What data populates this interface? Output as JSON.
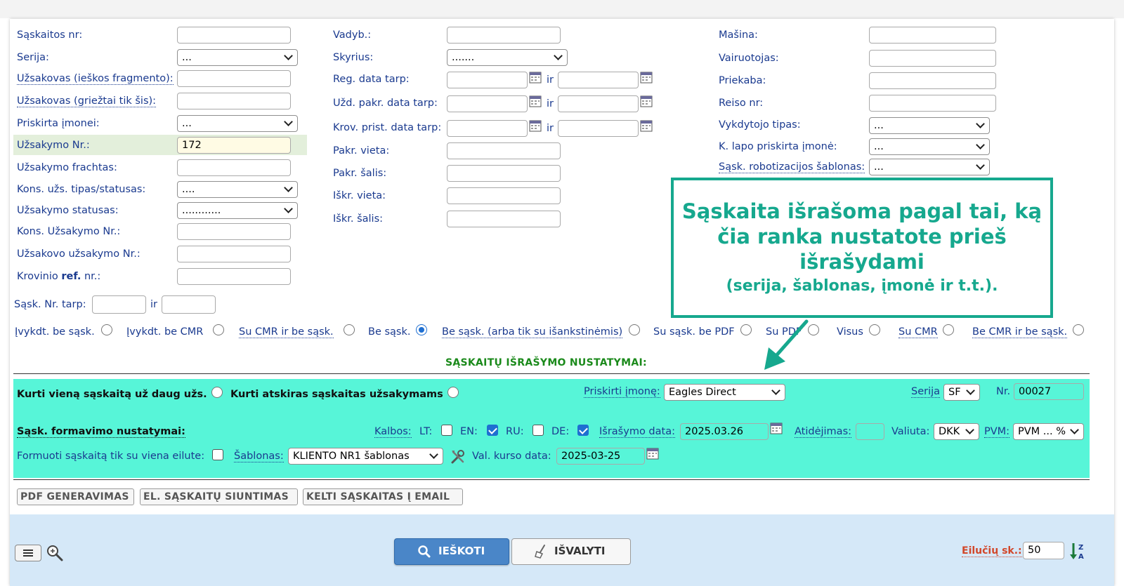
{
  "filters": {
    "col1": {
      "saskaitos_nr": {
        "label": "Sąskaitos nr:",
        "value": ""
      },
      "serija": {
        "label": "Serija:",
        "value": "..."
      },
      "uzsakovas_frag": {
        "label": "Užsakovas (ieškos fragmento):",
        "value": ""
      },
      "uzsakovas_griez": {
        "label": "Užsakovas (griežtai tik šis):",
        "value": ""
      },
      "priskirta_imonei": {
        "label": "Priskirta įmonei:",
        "value": "..."
      },
      "uzsakymo_nr": {
        "label": "Užsakymo Nr.:",
        "value": "172"
      },
      "uzsakymo_frachtas": {
        "label": "Užsakymo frachtas:",
        "value": ""
      },
      "kons_tipas": {
        "label": "Kons. užs. tipas/statusas:",
        "value": "...."
      },
      "uzsakymo_statusas": {
        "label": "Užsakymo statusas:",
        "value": "............"
      },
      "kons_uzsakymo_nr": {
        "label": "Kons. Užsakymo Nr.:",
        "value": ""
      },
      "uzsakovo_uzsakymo_nr": {
        "label": "Užsakovo užsakymo Nr.:",
        "value": ""
      },
      "krovinio_ref_pre": "Krovinio",
      "krovinio_ref_bold": "ref.",
      "krovinio_ref_post": "nr.:"
    },
    "col2": {
      "vadyb": {
        "label": "Vadyb.:",
        "value": ""
      },
      "skyrius": {
        "label": "Skyrius:",
        "value": "......."
      },
      "reg_data": {
        "label": "Reg. data tarp:",
        "ir": "ir"
      },
      "uzd_pakr": {
        "label": "Užd. pakr. data tarp:",
        "ir": "ir"
      },
      "krov_prist": {
        "label": "Krov. prist. data tarp:",
        "ir": "ir"
      },
      "pakr_vieta": {
        "label": "Pakr. vieta:",
        "value": ""
      },
      "pakr_salis": {
        "label": "Pakr. šalis:",
        "value": ""
      },
      "iskr_vieta": {
        "label": "Iškr. vieta:",
        "value": ""
      },
      "iskr_salis": {
        "label": "Iškr. šalis:",
        "value": ""
      }
    },
    "col3": {
      "masina": {
        "label": "Mašina:",
        "value": ""
      },
      "vairuotojas": {
        "label": "Vairuotojas:",
        "value": ""
      },
      "priekaba": {
        "label": "Priekaba:",
        "value": ""
      },
      "reiso_nr": {
        "label": "Reiso nr:",
        "value": ""
      },
      "vykdytojo_tipas": {
        "label": "Vykdytojo tipas:",
        "value": "..."
      },
      "k_lapo": {
        "label": "K. lapo priskirta įmonė:",
        "value": "..."
      },
      "robotizacijos": {
        "label": "Sąsk. robotizacijos šablonas:",
        "value": "..."
      }
    },
    "sask_nr_tarp": {
      "label": "Sąsk. Nr. tarp:",
      "ir": "ir"
    },
    "radios": [
      {
        "label": "Įvykdt. be sąsk.",
        "checked": false
      },
      {
        "label": "Įvykdt. be CMR",
        "checked": false
      },
      {
        "label": "Su CMR ir be sąsk.",
        "checked": false
      },
      {
        "label": "Be sąsk.",
        "checked": true
      },
      {
        "label": "Be sąsk. (arba tik su išankstinėmis)",
        "checked": false
      },
      {
        "label": "Su sąsk. be PDF",
        "checked": false
      },
      {
        "label": "Su PDF",
        "checked": false
      },
      {
        "label": "Visus",
        "checked": false
      },
      {
        "label": "Su CMR",
        "checked": false
      },
      {
        "label": "Be CMR ir be sąsk.",
        "checked": false
      }
    ]
  },
  "settings": {
    "title": "SĄSKAITŲ IŠRAŠYMO NUSTATYMAI:",
    "one_invoice": "Kurti vieną sąskaitą už daug užs.",
    "separate_invoices": "Kurti atskiras sąskaitas užsakymams",
    "priskirti_imone": {
      "label": "Priskirti įmonę:",
      "value": "Eagles Direct"
    },
    "serija": {
      "label": "Serija",
      "value": "SF"
    },
    "nr": {
      "label": "Nr.",
      "value": "00027"
    },
    "formavimo": "Sąsk. formavimo nustatymai:",
    "kalbos": "Kalbos:",
    "langs": [
      {
        "code": "LT:",
        "checked": false
      },
      {
        "code": "EN:",
        "checked": true
      },
      {
        "code": "RU:",
        "checked": false
      },
      {
        "code": "DE:",
        "checked": true
      }
    ],
    "israsymo_data": {
      "label": "Išrašymo data:",
      "value": "2025.03.26"
    },
    "atidejimas": {
      "label": "Atidėjimas:",
      "value": ""
    },
    "valiuta": {
      "label": "Valiuta:",
      "value": "DKK"
    },
    "pvm": {
      "label": "PVM:",
      "value": "PVM ... %"
    },
    "viena_eilute": "Formuoti sąskaitą tik su viena eilute:",
    "sablonas": {
      "label": "Šablonas:",
      "value": "KLIENTO NR1 šablonas"
    },
    "val_kurso": {
      "label": "Val. kurso data:",
      "value": "2025-03-25"
    }
  },
  "actions": {
    "pdf": "PDF GENERAVIMAS",
    "el_siuntimas": "EL. SĄSKAITŲ SIUNTIMAS",
    "email": "KELTI SĄSKAITAS Į EMAIL"
  },
  "toolbar": {
    "search": "IEŠKOTI",
    "clear": "IŠVALYTI",
    "rows_label": "Eilučių sk.:",
    "rows_value": "50"
  },
  "callout": {
    "line1": "Sąskaita išrašoma pagal tai, ką",
    "line2": "čia ranka nustatote prieš",
    "line3": "išrašydami",
    "line4": "(serija, šablonas, įmonė ir t.t.)."
  },
  "colors": {
    "accent_green": "#57f5d8",
    "callout": "#16a88e",
    "primary_btn": "#4a86c8"
  }
}
